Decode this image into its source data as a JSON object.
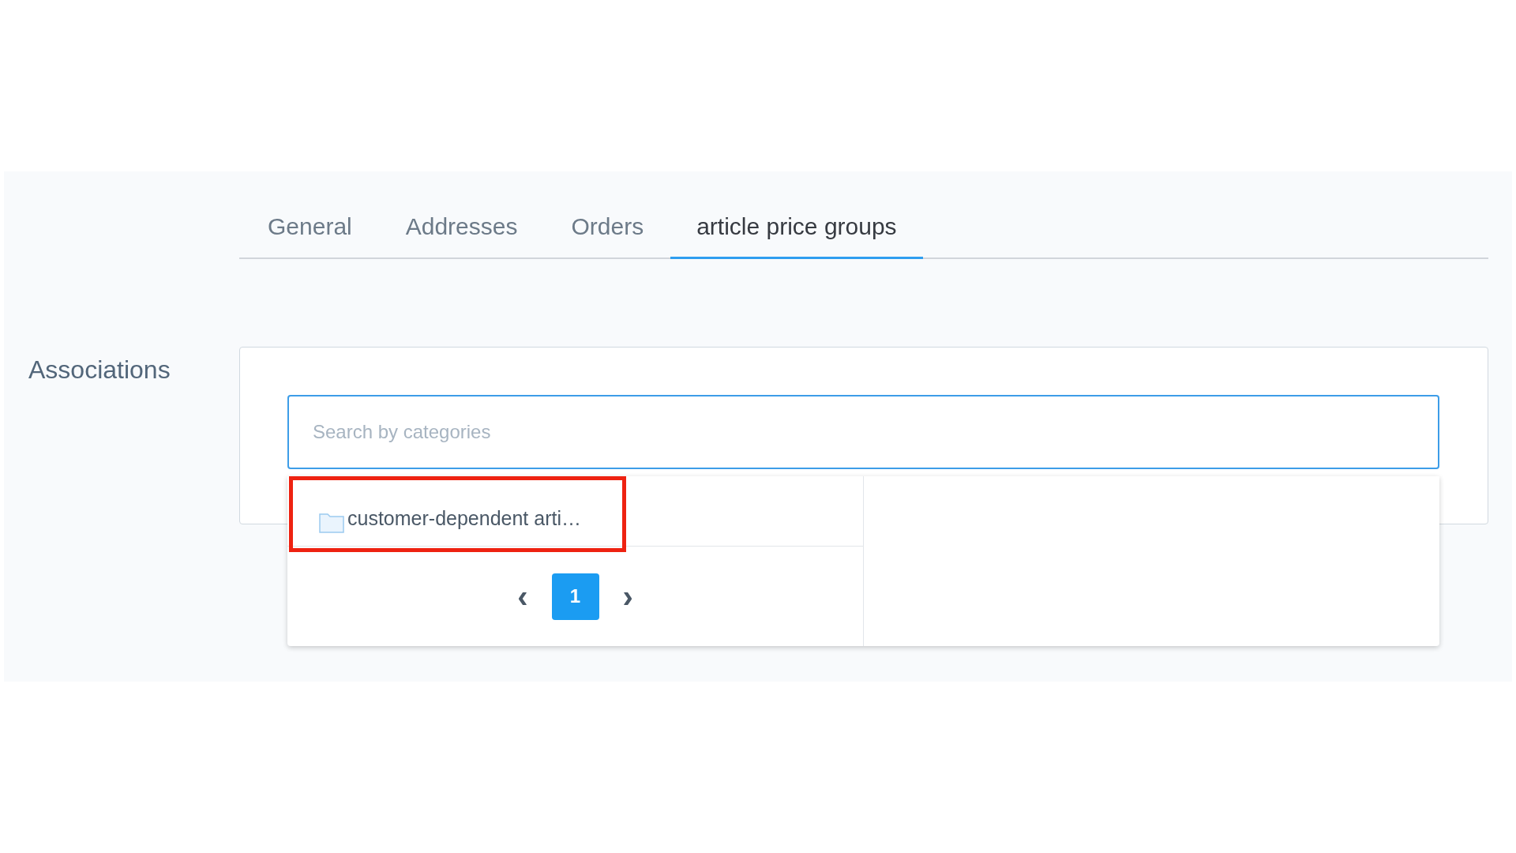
{
  "tabs": [
    {
      "label": "General",
      "selected": false
    },
    {
      "label": "Addresses",
      "selected": false
    },
    {
      "label": "Orders",
      "selected": false
    },
    {
      "label": "article price groups",
      "selected": true
    }
  ],
  "section": {
    "label": "Associations"
  },
  "search": {
    "placeholder": "Search by categories"
  },
  "results": {
    "items": [
      {
        "label": "customer-dependent arti…",
        "highlighted": true
      }
    ],
    "pagination": {
      "prev": "‹",
      "pages": [
        {
          "label": "1",
          "selected": true
        }
      ],
      "next": "›"
    }
  }
}
